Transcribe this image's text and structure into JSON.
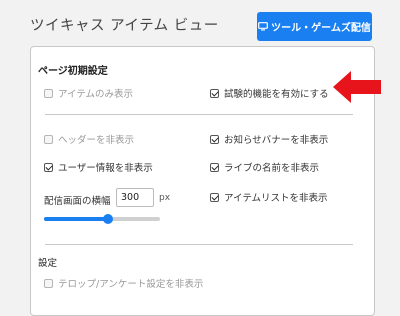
{
  "app": {
    "title": "ツイキャス アイテム ビュー"
  },
  "header": {
    "tools_button_label": "ツール・ゲームズ配信",
    "tools_icon": "monitor-icon"
  },
  "page_settings": {
    "heading": "ページ初期設定",
    "items_only": {
      "label": "アイテムのみ表示",
      "checked": false,
      "disabled": true
    },
    "experimental": {
      "label": "試験的機能を有効にする",
      "checked": true
    },
    "hide_header": {
      "label": "ヘッダーを非表示",
      "checked": false,
      "disabled": true
    },
    "hide_notice_banner": {
      "label": "お知らせバナーを非表示",
      "checked": true
    },
    "hide_user_info": {
      "label": "ユーザー情報を非表示",
      "checked": true
    },
    "hide_live_name": {
      "label": "ライブの名前を非表示",
      "checked": true
    },
    "hide_item_list": {
      "label": "アイテムリストを非表示",
      "checked": true
    },
    "screen_width": {
      "label": "配信画面の横幅",
      "value": "300",
      "unit": "px",
      "slider_fraction": 0.55
    }
  },
  "settings": {
    "heading": "設定",
    "hide_telop_survey": {
      "label": "テロップ/アンケート設定を非表示",
      "checked": false,
      "disabled": true
    }
  },
  "colors": {
    "accent": "#1a7ff0",
    "arrow": "#e8141b"
  }
}
